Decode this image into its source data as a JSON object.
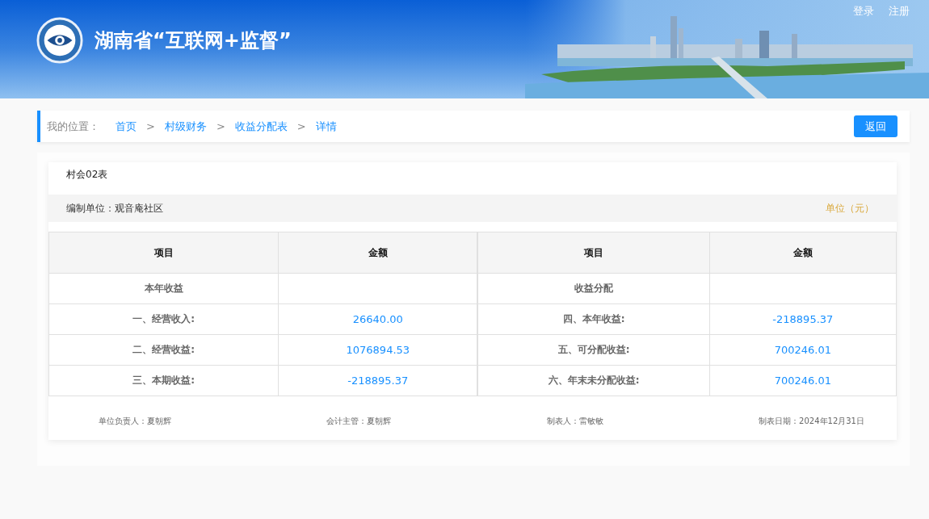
{
  "header": {
    "title": "湖南省“互联网+监督”",
    "links": [
      "登录",
      "注册"
    ]
  },
  "breadcrumb": {
    "label": "我的位置：",
    "separator": ">",
    "items": [
      "首页",
      "村级财务",
      "收益分配表",
      "详情"
    ]
  },
  "back_button": "返回",
  "report": {
    "form_code": "村会02表",
    "compiler": "编制单位：观音庵社区",
    "unit": "单位（元）",
    "table": {
      "columns": [
        "项目",
        "金额",
        "项目",
        "金额"
      ],
      "rows": [
        [
          "本年收益",
          "",
          "收益分配",
          ""
        ],
        [
          "一、经营收入:",
          "26640.00",
          "四、本年收益:",
          "-218895.37"
        ],
        [
          "二、经营收益:",
          "1076894.53",
          "五、可分配收益:",
          "700246.01"
        ],
        [
          "三、本期收益:",
          "-218895.37",
          "六、年末未分配收益:",
          "700246.01"
        ]
      ]
    },
    "signatures": [
      "单位负责人：夏朝辉",
      "会计主管：夏朝辉",
      "制表人：雷敏敏",
      "制表日期：2024年12月31日"
    ]
  }
}
